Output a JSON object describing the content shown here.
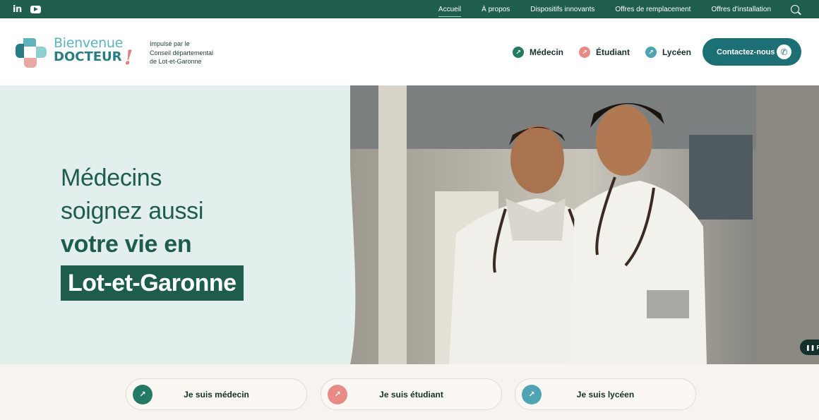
{
  "social": {
    "linkedin": "in",
    "youtube_icon": "youtube-icon"
  },
  "topnav": [
    {
      "label": "Accueil",
      "active": true
    },
    {
      "label": "À propos"
    },
    {
      "label": "Dispositifs innovants"
    },
    {
      "label": "Offres de remplacement"
    },
    {
      "label": "Offres d'installation"
    }
  ],
  "brand": {
    "line1": "Bienvenue",
    "line2": "DOCTEUR",
    "exclamation": "!",
    "tagline": [
      "Impulsé par le",
      "Conseil départemental",
      "de Lot-et-Garonne"
    ]
  },
  "audience_nav": [
    {
      "label": "Médecin",
      "color": "#237a64"
    },
    {
      "label": "Étudiant",
      "color": "#e88b86"
    },
    {
      "label": "Lycéen",
      "color": "#4fa4b3"
    }
  ],
  "cta": {
    "label": "Contactez-nous",
    "icon": "phone-icon"
  },
  "hero": {
    "line1": "Médecins",
    "line2": "soignez aussi",
    "line3": "votre vie en",
    "highlight": "Lot-et-Garonne",
    "pause_label": "P"
  },
  "quick_links": [
    {
      "label": "Je suis médecin",
      "color": "#237a64"
    },
    {
      "label": "Je suis étudiant",
      "color": "#e88b86"
    },
    {
      "label": "Je suis lycéen",
      "color": "#4fa4b3"
    }
  ],
  "colors": {
    "topbar": "#1f5d4d",
    "hero_bg": "#e2efec",
    "primary": "#1e5d4e",
    "cta": "#1d6f76"
  }
}
